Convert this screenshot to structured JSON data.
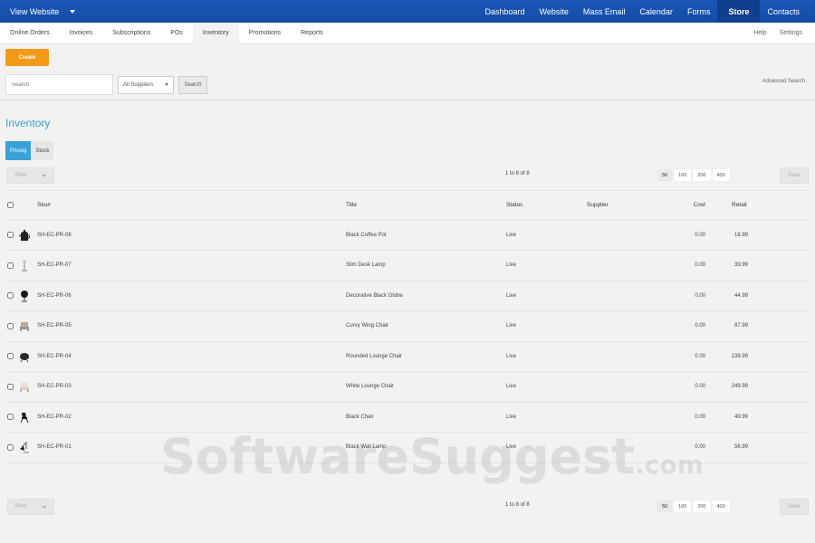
{
  "topbar": {
    "view_website": "View Website",
    "nav": [
      "Dashboard",
      "Website",
      "Mass Email",
      "Calendar",
      "Forms",
      "Store",
      "Contacts"
    ],
    "active": "Store"
  },
  "subnav": {
    "left": [
      "Online Orders",
      "Invoices",
      "Subscriptions",
      "POs",
      "Inventory",
      "Promotions",
      "Reports"
    ],
    "active": "Inventory",
    "right": [
      "Help",
      "Settings"
    ]
  },
  "actions": {
    "create_label": "Create",
    "search_placeholder": "Search",
    "supplier_select": "All Suppliers",
    "search_button": "Search",
    "advanced_search": "Advanced Search"
  },
  "section": {
    "title": "Inventory",
    "tabs": [
      "Pricing",
      "Stock"
    ],
    "active_tab": "Pricing"
  },
  "pager": {
    "print_label": "Print",
    "info": "1 to 8 of 8",
    "page_sizes": [
      "50",
      "100",
      "200",
      "400"
    ],
    "active_size": "50",
    "save_label": "Save"
  },
  "table": {
    "columns": {
      "sku": "Sku#",
      "title": "Title",
      "status": "Status",
      "supplier": "Supplier",
      "cost": "Cost",
      "retail": "Retail"
    },
    "rows": [
      {
        "sku": "SH-EC-PR-08",
        "title": "Black Coffee Pot",
        "status": "Live",
        "supplier": "",
        "cost": "0.00",
        "retail": "18.99",
        "thumb": "coffee-pot-icon"
      },
      {
        "sku": "SH-EC-PR-07",
        "title": "Slim Desk Lamp",
        "status": "Live",
        "supplier": "",
        "cost": "0.00",
        "retail": "39.99",
        "thumb": "desk-lamp-icon"
      },
      {
        "sku": "SH-EC-PR-06",
        "title": "Decorative Black Globe",
        "status": "Live",
        "supplier": "",
        "cost": "0.00",
        "retail": "44.99",
        "thumb": "globe-icon"
      },
      {
        "sku": "SH-EC-PR-05",
        "title": "Curvy Wing Chair",
        "status": "Live",
        "supplier": "",
        "cost": "0.00",
        "retail": "87.99",
        "thumb": "wing-chair-icon"
      },
      {
        "sku": "SH-EC-PR-04",
        "title": "Rounded Lounge Chair",
        "status": "Live",
        "supplier": "",
        "cost": "0.00",
        "retail": "139.99",
        "thumb": "lounge-chair-icon"
      },
      {
        "sku": "SH-EC-PR-03",
        "title": "White Lounge Chair",
        "status": "Live",
        "supplier": "",
        "cost": "0.00",
        "retail": "249.99",
        "thumb": "white-chair-icon"
      },
      {
        "sku": "SH-EC-PR-02",
        "title": "Black Chair",
        "status": "Live",
        "supplier": "",
        "cost": "0.00",
        "retail": "49.99",
        "thumb": "black-chair-icon"
      },
      {
        "sku": "SH-EC-PR-01",
        "title": "Black Wall Lamp",
        "status": "Live",
        "supplier": "",
        "cost": "0.00",
        "retail": "56.99",
        "thumb": "wall-lamp-icon"
      }
    ]
  },
  "watermark": {
    "text": "SoftwareSuggest",
    "suffix": ".com"
  }
}
